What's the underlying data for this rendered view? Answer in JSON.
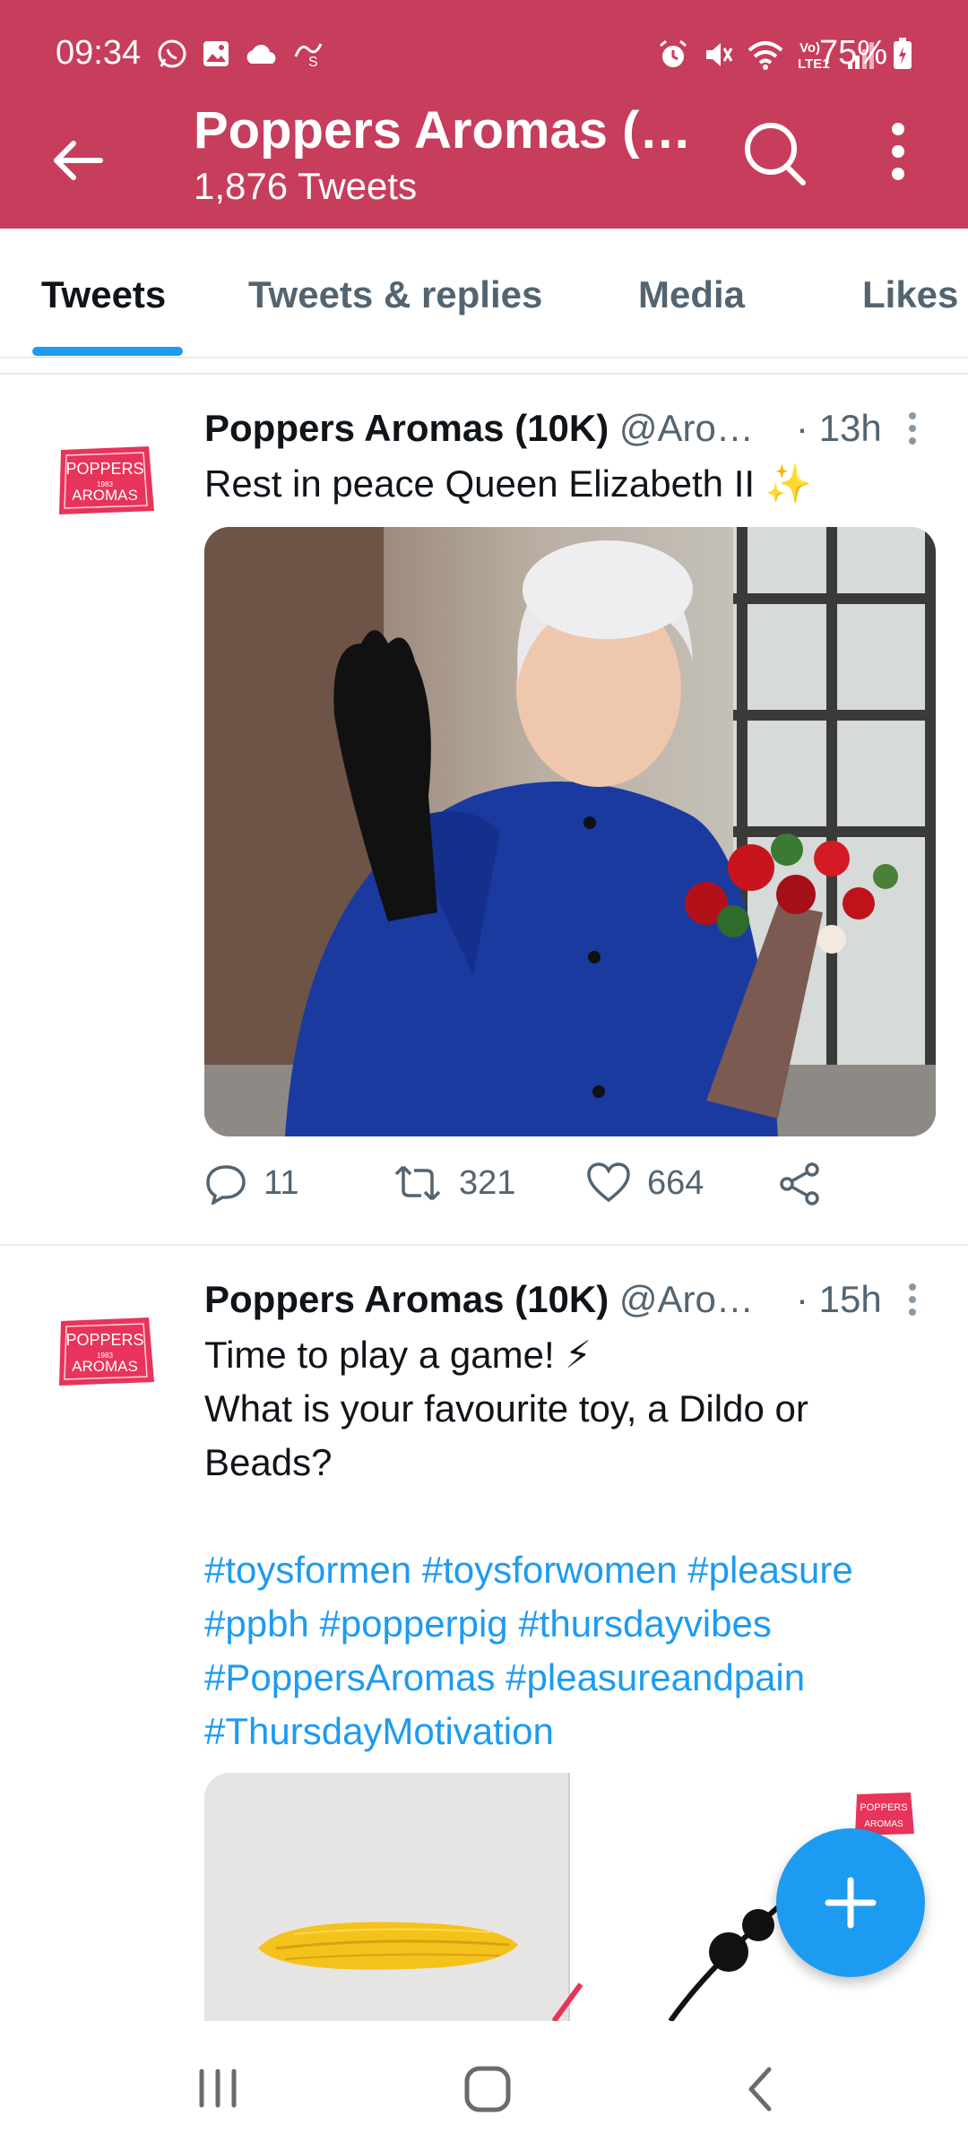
{
  "status_bar": {
    "time": "09:34",
    "battery": "75%",
    "left_icons": [
      "whatsapp-icon",
      "gallery-icon",
      "cloud-icon",
      "notification-icon"
    ],
    "right_icons": [
      "alarm-icon",
      "mute-icon",
      "wifi-icon",
      "volte-icon",
      "signal-icon"
    ]
  },
  "header": {
    "title": "Poppers Aromas (…",
    "subtitle": "1,876 Tweets",
    "brand_color": "#c73d5c"
  },
  "tabs": [
    {
      "label": "Tweets",
      "active": true
    },
    {
      "label": "Tweets & replies",
      "active": false
    },
    {
      "label": "Media",
      "active": false
    },
    {
      "label": "Likes",
      "active": false
    }
  ],
  "avatar": {
    "line1": "POPPERS",
    "line2": "1983",
    "line3": "AROMAS"
  },
  "tweets": [
    {
      "name": "Poppers Aromas (10K)",
      "handle": "@Aro…",
      "time": "· 13h",
      "text": "Rest in peace Queen Elizabeth II ✨",
      "replies": "11",
      "retweets": "321",
      "likes": "664"
    },
    {
      "name": "Poppers Aromas (10K)",
      "handle": "@Aro…",
      "time": "· 15h",
      "line1": "Time to play a game! ⚡",
      "line2": "What is your favourite toy, a Dildo or",
      "line3": "Beads?",
      "hashtags": [
        "#toysformen",
        "#toysforwomen",
        "#pleasure",
        "#ppbh",
        "#popperpig",
        "#thursdayvibes",
        "#PoppersAromas",
        "#pleasureandpain",
        "#ThursdayMotivation"
      ]
    }
  ],
  "colors": {
    "accent": "#1d9bf0",
    "secondary_text": "#536471"
  }
}
